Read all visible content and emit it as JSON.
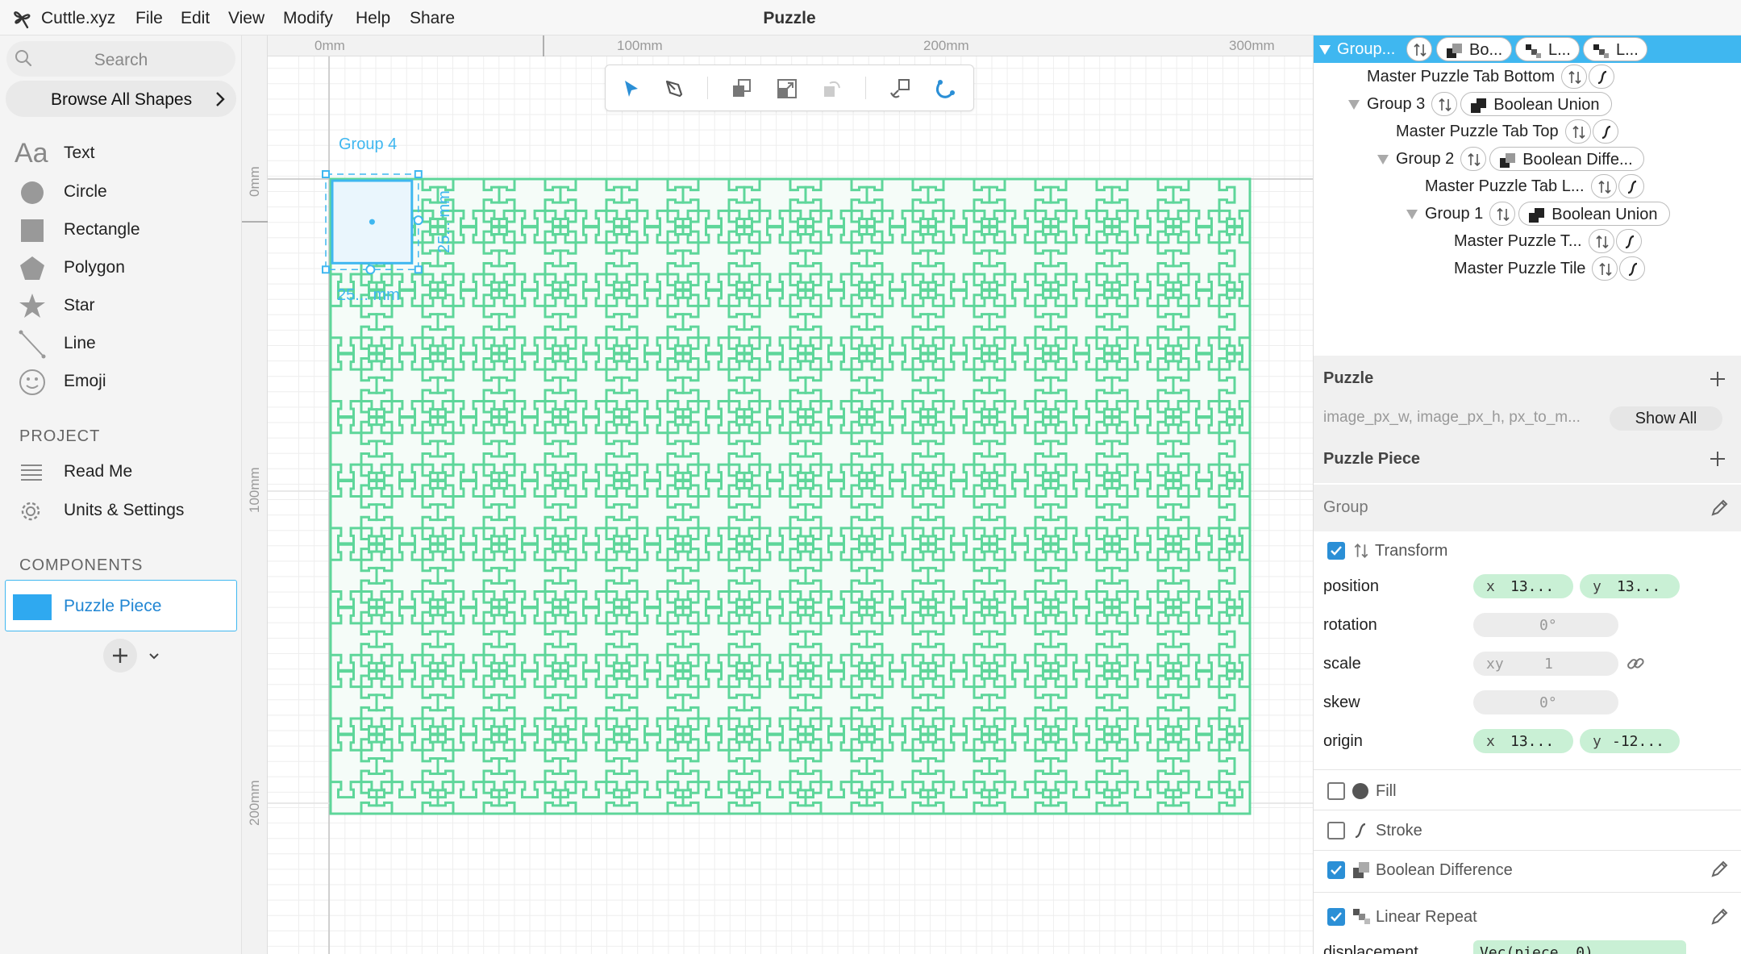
{
  "app": {
    "name": "Cuttle.xyz",
    "doc_title": "Puzzle"
  },
  "menu": [
    "File",
    "Edit",
    "View",
    "Modify",
    "Help",
    "Share"
  ],
  "sidebar": {
    "search_placeholder": "Search",
    "browse_label": "Browse All Shapes",
    "shapes": [
      {
        "label": "Text",
        "icon": "text-icon",
        "glyph": "Aa"
      },
      {
        "label": "Circle",
        "icon": "circle-icon"
      },
      {
        "label": "Rectangle",
        "icon": "rectangle-icon"
      },
      {
        "label": "Polygon",
        "icon": "polygon-icon"
      },
      {
        "label": "Star",
        "icon": "star-icon"
      },
      {
        "label": "Line",
        "icon": "line-icon"
      },
      {
        "label": "Emoji",
        "icon": "emoji-icon"
      }
    ],
    "project_title": "PROJECT",
    "project_items": [
      {
        "label": "Read Me",
        "icon": "document-lines-icon"
      },
      {
        "label": "Units & Settings",
        "icon": "gear-icon"
      }
    ],
    "components_title": "COMPONENTS",
    "component": {
      "label": "Puzzle Piece",
      "thumb_color": "#2fa9f0"
    }
  },
  "canvas": {
    "ruler_top": [
      "0mm",
      "100mm",
      "200mm",
      "300mm"
    ],
    "ruler_left": [
      "0mm",
      "100mm",
      "200mm"
    ],
    "selection": {
      "group_label": "Group 4",
      "width_label": "25... mm",
      "height_label": "25... mm"
    },
    "toolbar_tools": [
      "pointer-tool-icon",
      "pen-tool-icon",
      "bring-front-icon",
      "scale-icon",
      "rotate-icon",
      "grab-icon",
      "magnet-icon"
    ],
    "puzzle_grid": {
      "cols": 30,
      "rows": 20
    },
    "colors": {
      "puzzle_stroke": "#5ed69a",
      "puzzle_fill": "#f5fcf8",
      "selection": "#3fb7f0"
    }
  },
  "tree": [
    {
      "label": "Group...",
      "pills": [
        "Bo...",
        "L...",
        "L..."
      ],
      "selected": true
    },
    {
      "label": "Master Puzzle Tab Bottom"
    },
    {
      "label": "Group 3",
      "pill": "Boolean Union"
    },
    {
      "label": "Master Puzzle Tab Top"
    },
    {
      "label": "Group 2",
      "pill": "Boolean Diffe..."
    },
    {
      "label": "Master Puzzle Tab L..."
    },
    {
      "label": "Group 1",
      "pill": "Boolean Union"
    },
    {
      "label": "Master Puzzle T..."
    },
    {
      "label": "Master Puzzle Tile"
    }
  ],
  "params": {
    "puzzle_title": "Puzzle",
    "puzzle_params_text": "image_px_w, image_px_h, px_to_m...",
    "show_all_label": "Show All",
    "piece_title": "Puzzle Piece",
    "group_label": "Group"
  },
  "transform": {
    "title": "Transform",
    "position_label": "position",
    "position_x": "13...",
    "position_y": "13...",
    "rotation_label": "rotation",
    "rotation_value": "0°",
    "scale_label": "scale",
    "scale_xy": "xy",
    "scale_value": "1",
    "skew_label": "skew",
    "skew_value": "0°",
    "origin_label": "origin",
    "origin_x": "13...",
    "origin_y": "-12...",
    "x_label": "x",
    "y_label": "y"
  },
  "modifiers": {
    "fill": "Fill",
    "stroke": "Stroke",
    "boolean_difference": "Boolean Difference",
    "linear_repeat": "Linear Repeat",
    "displacement_label": "displacement",
    "displacement_value": "Vec(piece, 0)"
  }
}
